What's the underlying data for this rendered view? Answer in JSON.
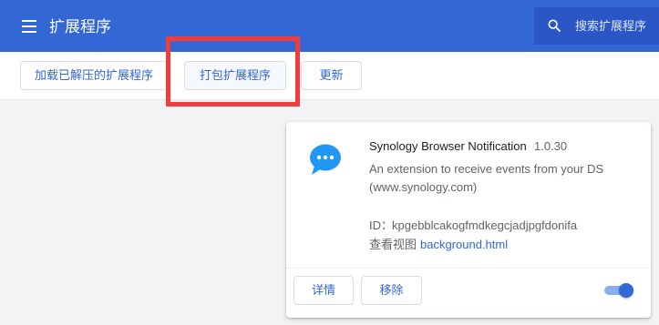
{
  "header": {
    "title": "扩展程序",
    "menu_icon": "hamburger-menu-icon",
    "search": {
      "icon": "search-icon",
      "placeholder": "搜索扩展程序"
    }
  },
  "toolbar": {
    "load_unpacked_label": "加载已解压的扩展程序",
    "pack_extension_label": "打包扩展程序",
    "update_label": "更新"
  },
  "extension": {
    "icon": "speech-bubble-icon",
    "name": "Synology Browser Notification",
    "version": "1.0.30",
    "description": "An extension to receive events from your DS (www.synology.com)",
    "id_label": "ID：",
    "id_value": "kpgebblcakogfmdkegcjadjpgfdonifa",
    "views_label": "查看视图",
    "views_link": "background.html",
    "details_label": "详情",
    "remove_label": "移除",
    "enabled": true
  },
  "colors": {
    "header_bg": "#3367d6",
    "accent": "#3367d6",
    "highlight_box": "#ef3c3c",
    "icon_blue": "#2196f3"
  }
}
